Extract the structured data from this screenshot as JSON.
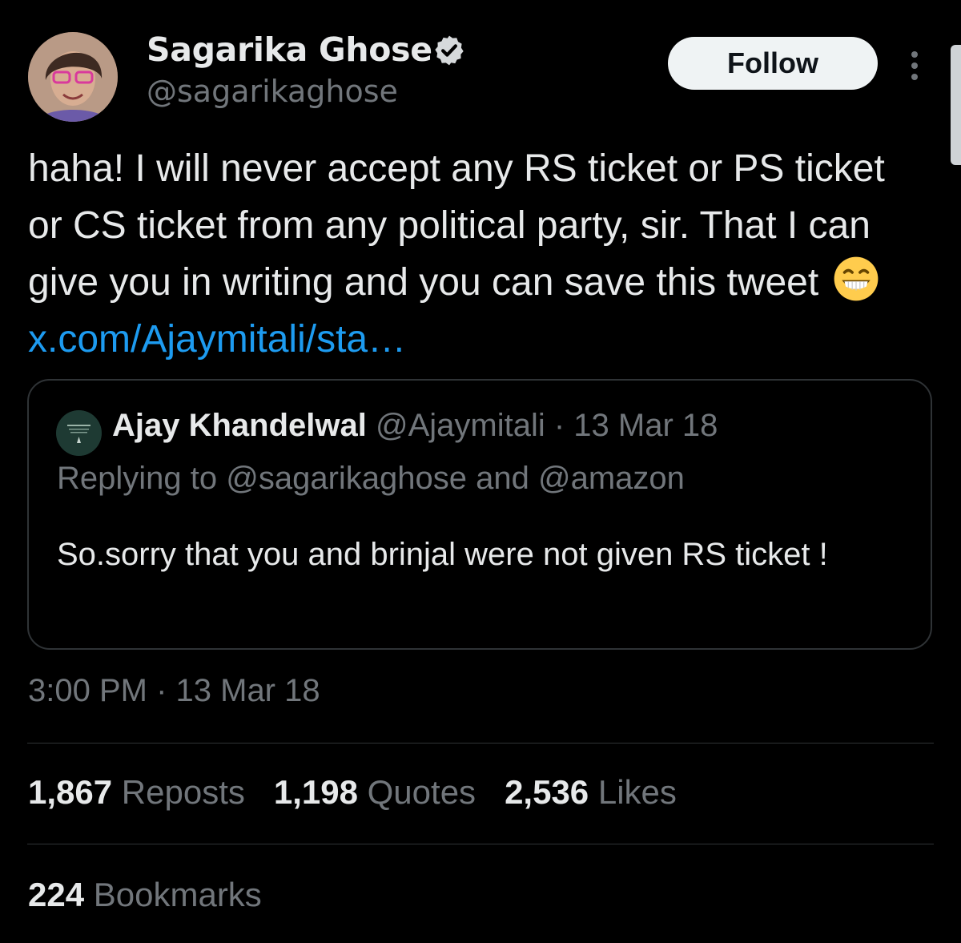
{
  "author": {
    "name": "Sagarika Ghose",
    "handle": "@sagarikaghose",
    "avatar_icon": "profile-photo",
    "verified_icon": "verified-badge-icon"
  },
  "actions": {
    "follow_label": "Follow",
    "more_icon": "more-vertical-icon"
  },
  "tweet": {
    "text_main": "haha! I will never accept any RS ticket or PS ticket or CS ticket from any political party, sir. That I can give you in writing and you can save this tweet",
    "emoji_icon": "grinning-face-emoji",
    "link": "x.com/Ajaymitali/sta…"
  },
  "quoted_tweet": {
    "name": "Ajay Khandelwal",
    "meta": "@Ajaymitali · 13 Mar 18",
    "replying_to": "Replying to @sagarikaghose and @amazon",
    "text": "So.sorry that you and brinjal were not given RS ticket !"
  },
  "timestamp": "3:00 PM · 13 Mar 18",
  "stats": [
    {
      "count": "1,867",
      "label": "Reposts"
    },
    {
      "count": "1,198",
      "label": "Quotes"
    },
    {
      "count": "2,536",
      "label": "Likes"
    }
  ],
  "bookmarks": {
    "count": "224",
    "label": "Bookmarks"
  },
  "colors": {
    "background": "#000000",
    "text": "#e7e9ea",
    "muted": "#71767b",
    "link": "#1d9bf0",
    "border": "#2f3336",
    "follow_bg": "#eff3f4"
  }
}
